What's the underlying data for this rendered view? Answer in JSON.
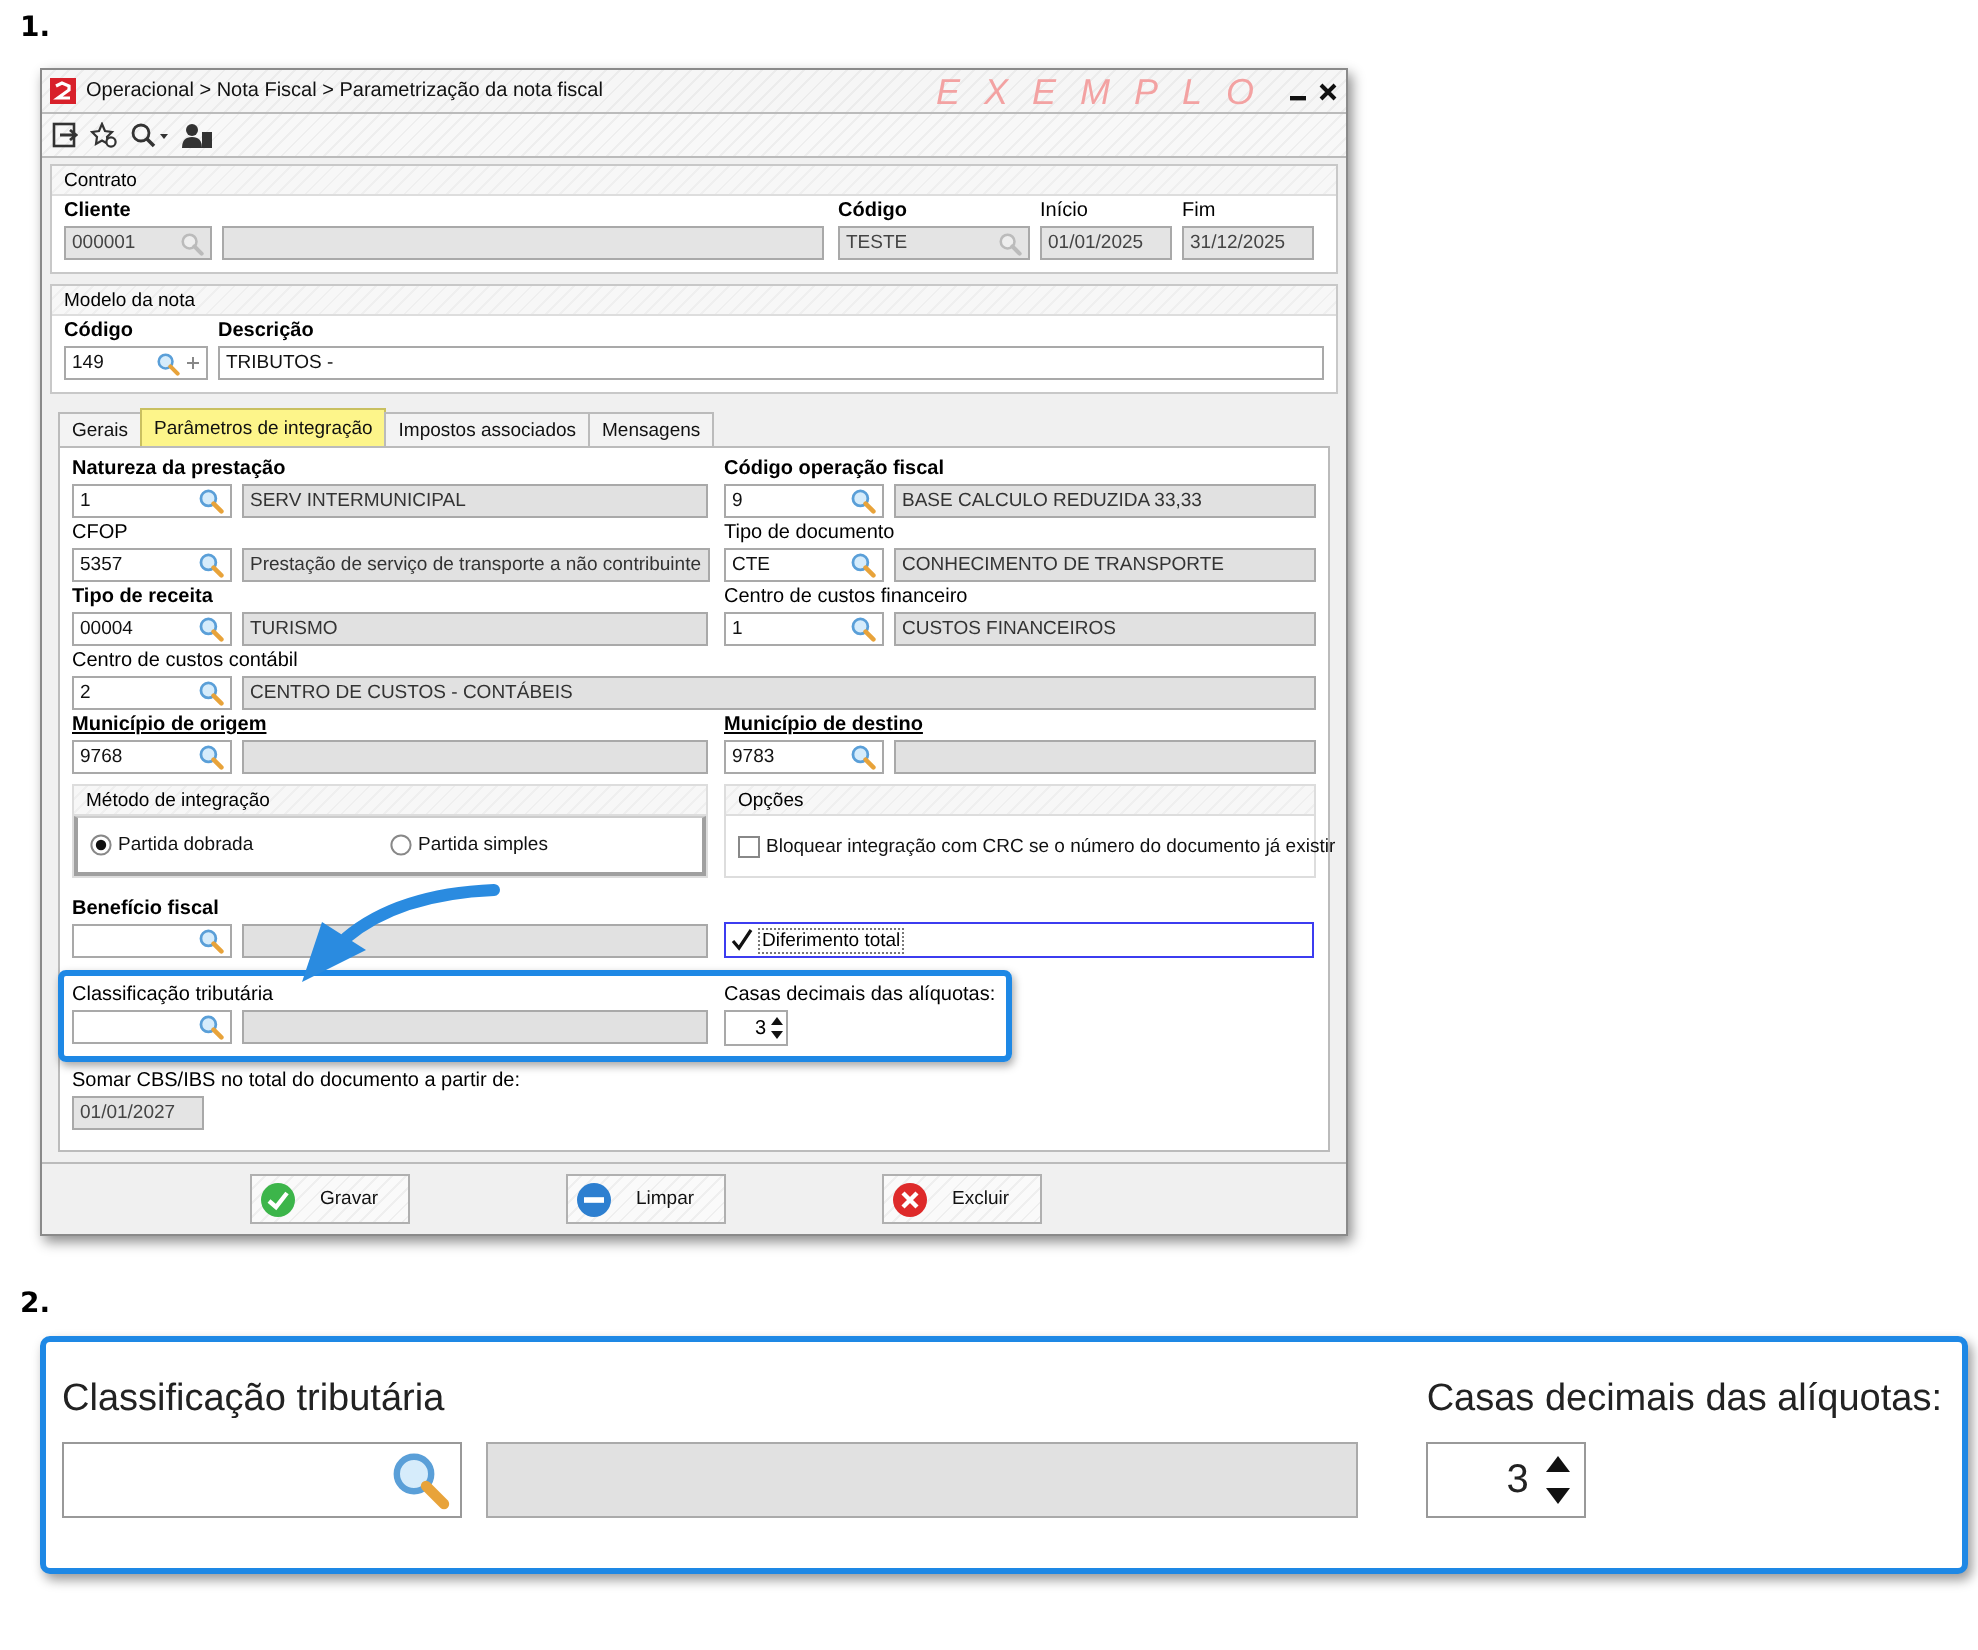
{
  "figure_1": {
    "number": "1.",
    "window": {
      "title": "Operacional > Nota Fiscal > Parametrização da nota fiscal",
      "environment_label": "EXEMPLO",
      "contrato": {
        "title": "Contrato",
        "cliente": {
          "label": "Cliente",
          "code": "000001"
        },
        "codigo": {
          "label": "Código",
          "value": "TESTE"
        },
        "inicio": {
          "label": "Início",
          "value": "01/01/2025"
        },
        "fim": {
          "label": "Fim",
          "value": "31/12/2025"
        }
      },
      "modelo": {
        "title": "Modelo da nota",
        "codigo": {
          "label": "Código",
          "value": "149"
        },
        "descricao": {
          "label": "Descrição",
          "value": "TRIBUTOS -"
        }
      },
      "tabs": [
        {
          "label": "Gerais",
          "selected": false
        },
        {
          "label": "Parâmetros de integração",
          "selected": true
        },
        {
          "label": "Impostos associados",
          "selected": false
        },
        {
          "label": "Mensagens",
          "selected": false
        }
      ],
      "rows": [
        [
          {
            "label": "Natureza da prestação",
            "kind": "bold",
            "code": "1",
            "description": "SERV INTERMUNICIPAL"
          },
          {
            "label": "Código operação fiscal",
            "kind": "bold",
            "code": "9",
            "description": "BASE CALCULO REDUZIDA 33,33"
          }
        ],
        [
          {
            "label": "CFOP",
            "kind": "plain",
            "code": "5357",
            "description": "Prestação de serviço de transporte a não contribuinte"
          },
          {
            "label": "Tipo de documento",
            "kind": "plain",
            "code": "CTE",
            "description": "CONHECIMENTO DE TRANSPORTE"
          }
        ],
        [
          {
            "label": "Tipo de receita",
            "kind": "bold",
            "code": "00004",
            "description": "TURISMO"
          },
          {
            "label": "Centro de custos financeiro",
            "kind": "plain",
            "code": "1",
            "description": "CUSTOS FINANCEIROS"
          }
        ],
        [
          {
            "label": "Centro de custos contábil",
            "kind": "plain",
            "code": "2",
            "description": "CENTRO DE CUSTOS - CONTÁBEIS"
          }
        ],
        [
          {
            "label": "Município de origem",
            "kind": "link",
            "code": "9768"
          },
          {
            "label": "Município de destino",
            "kind": "link",
            "code": "9783"
          }
        ]
      ],
      "metodo": {
        "title": "Método de integração",
        "options": [
          {
            "label": "Partida dobrada",
            "selected": true
          },
          {
            "label": "Partida simples",
            "selected": false
          }
        ]
      },
      "opcoes": {
        "title": "Opções",
        "items": [
          {
            "label": "Bloquear integração com CRC se o número do documento já existir",
            "checked": false
          }
        ]
      },
      "beneficio": {
        "label": "Benefício fiscal",
        "kind": "bold"
      },
      "diferimento": {
        "label": "Diferimento total",
        "checked": true
      },
      "classificacao": {
        "label": "Classificação tributária"
      },
      "casas": {
        "label": "Casas decimais das alíquotas:",
        "value": "3"
      },
      "somar": {
        "label": "Somar CBS/IBS no total do documento a partir de:",
        "value": "01/01/2027"
      },
      "buttons": [
        {
          "label": "Gravar",
          "kind": "save"
        },
        {
          "label": "Limpar",
          "kind": "clear"
        },
        {
          "label": "Excluir",
          "kind": "delete"
        }
      ]
    }
  },
  "figure_2": {
    "number": "2.",
    "classificacao": {
      "label": "Classificação tributária"
    },
    "casas": {
      "label": "Casas decimais das alíquotas:",
      "value": "3"
    }
  }
}
